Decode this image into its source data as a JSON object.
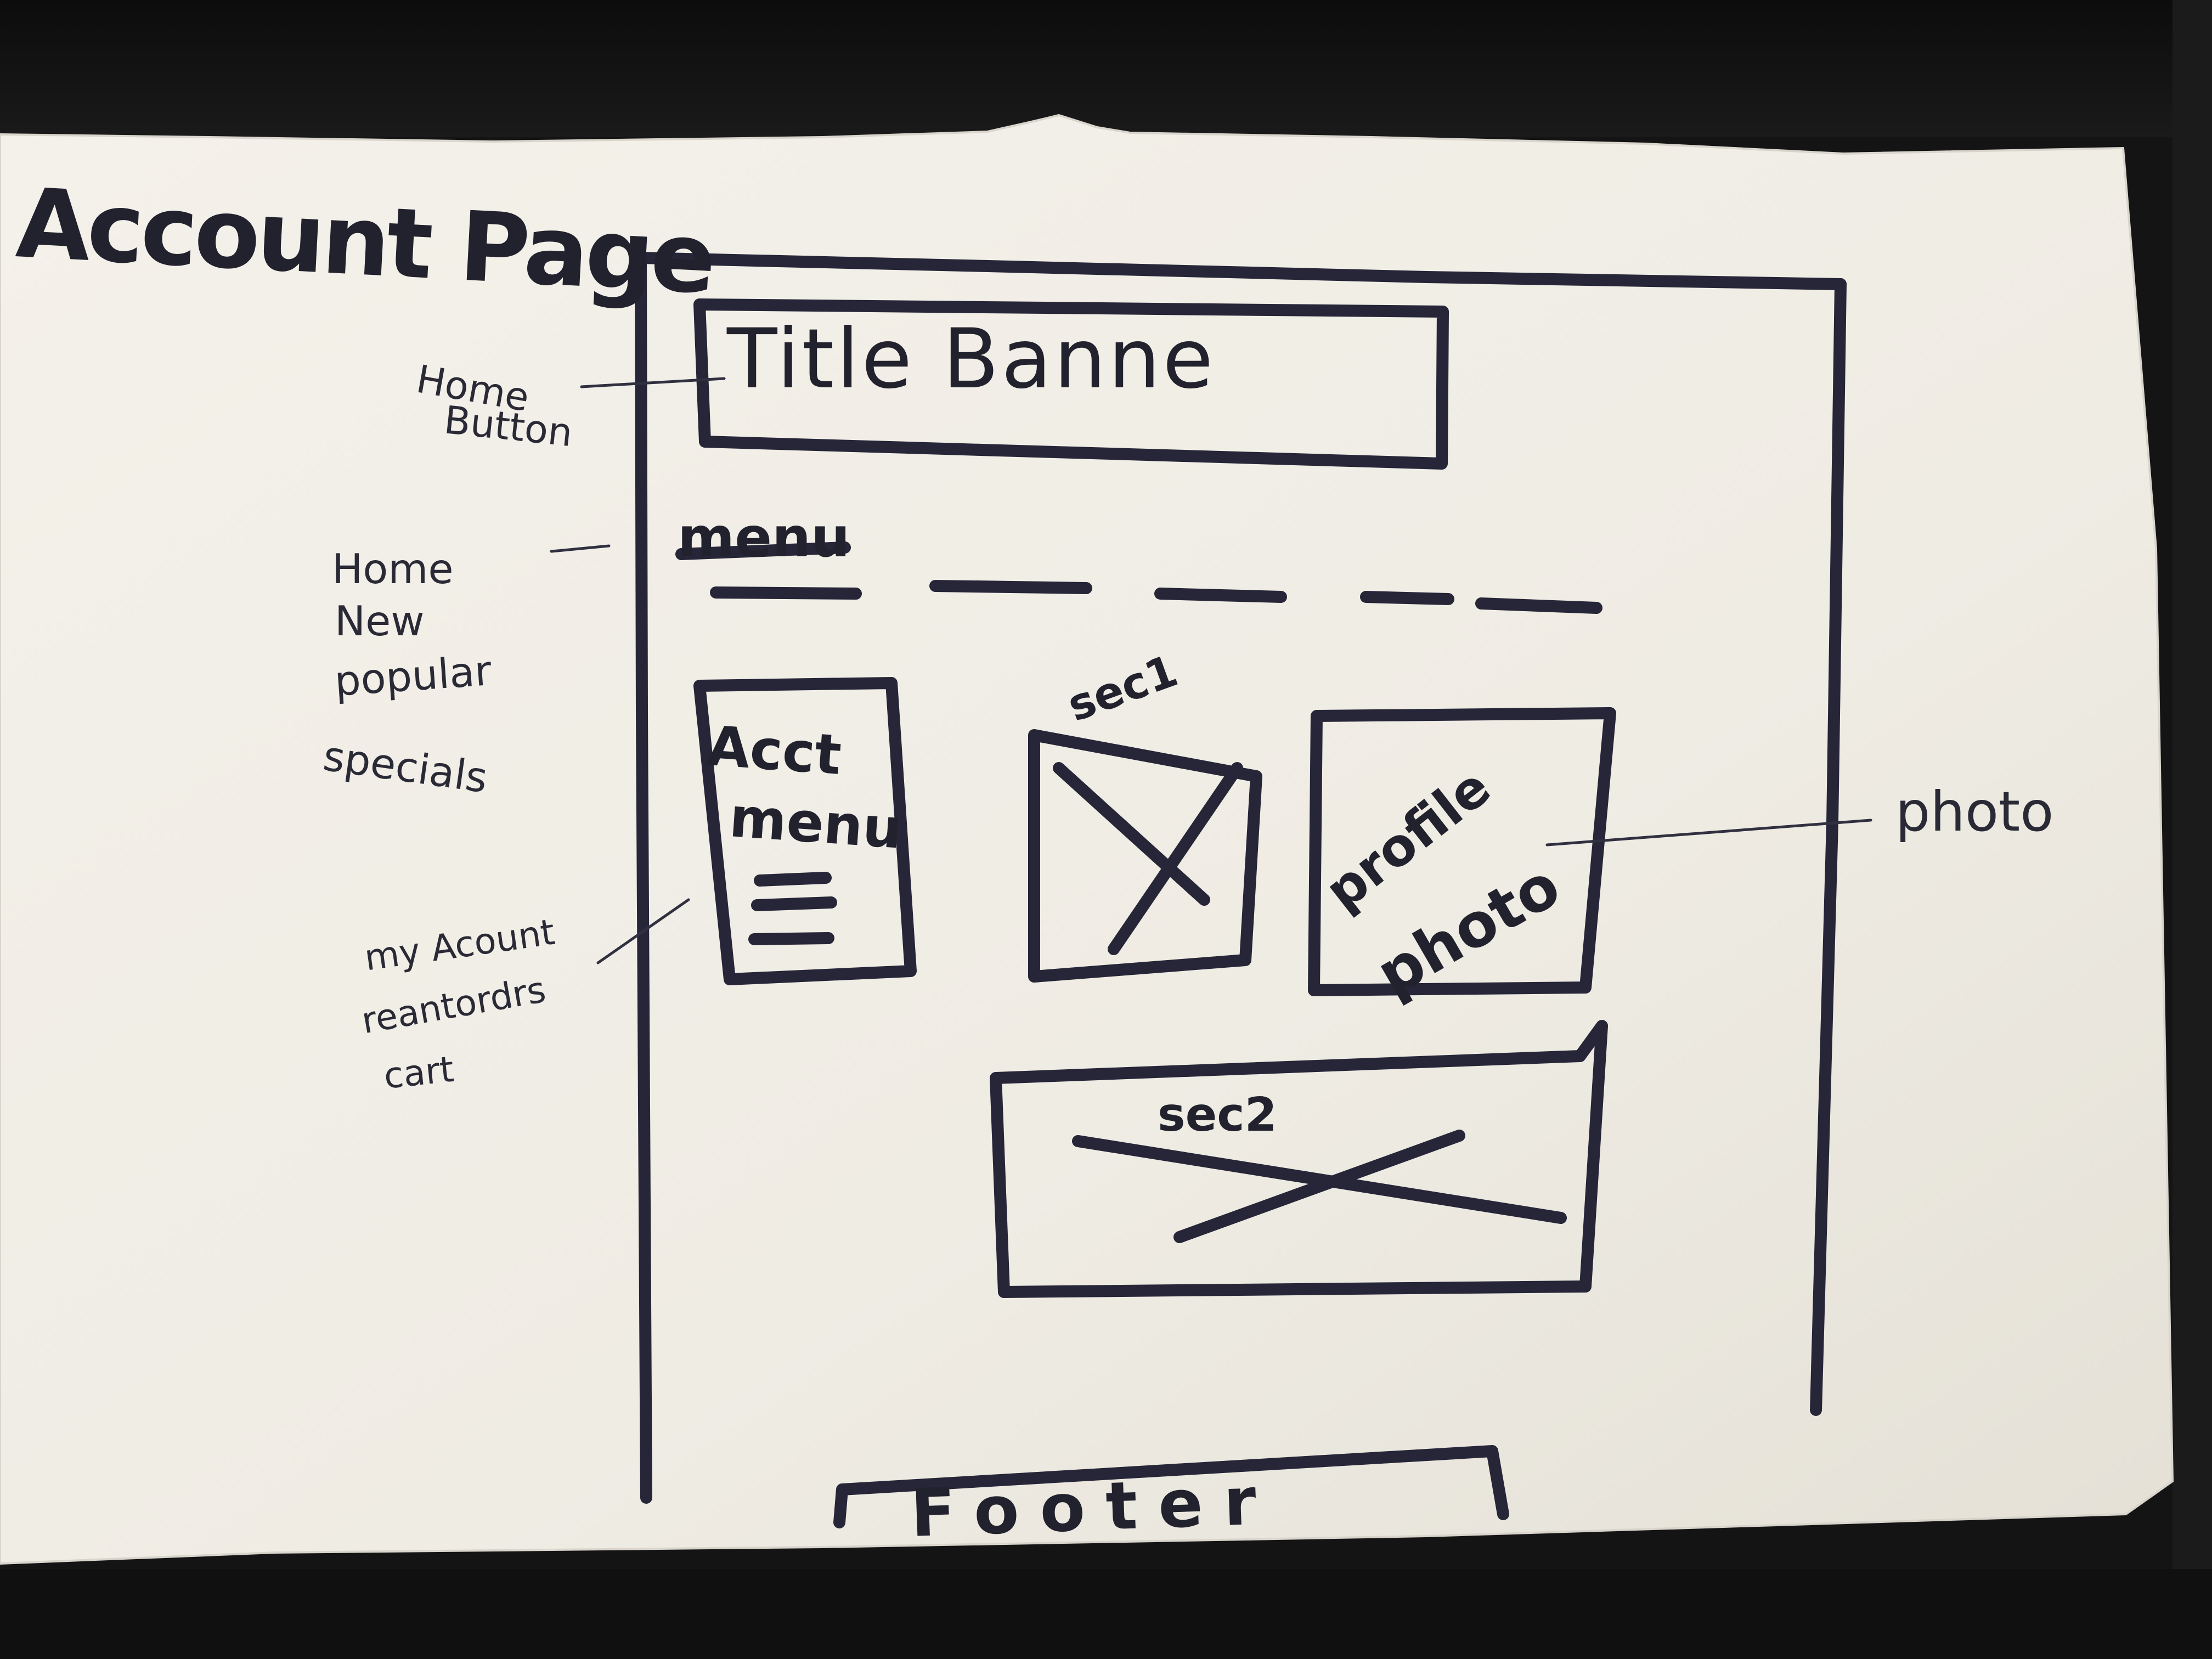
{
  "page_label": "Account Page",
  "wireframe": {
    "title_banner": "Title Banne",
    "menu_label": "menu",
    "account_menu": {
      "line1": "Acct",
      "line2": "menu"
    },
    "section_1_label": "sec1",
    "profile_photo": {
      "line1": "profile",
      "line2": "photo"
    },
    "section_2_label": "sec2",
    "footer": "Footer"
  },
  "annotations": {
    "home_button": [
      "Home",
      "Button"
    ],
    "nav_items": [
      "Home",
      "New",
      "popular",
      "specials"
    ],
    "account_items": [
      "my Acount",
      "reantordrs",
      "cart"
    ],
    "photo_note": "photo"
  },
  "colors": {
    "paper": "#f2efe8",
    "ink": "#24243a",
    "background": "#141414"
  }
}
